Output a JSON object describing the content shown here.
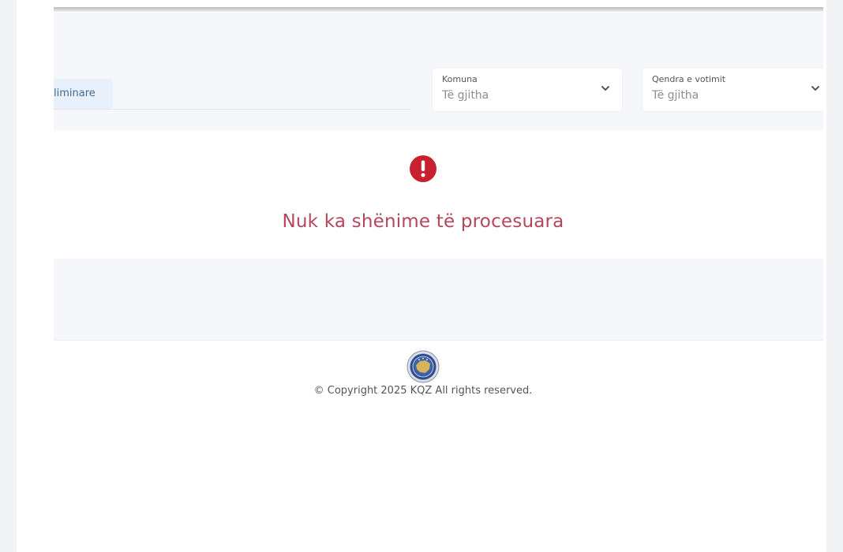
{
  "filters": {
    "tab_label": "liminare",
    "komuna": {
      "label": "Komuna",
      "value": "Të gjitha"
    },
    "qendra": {
      "label": "Qendra e votimit",
      "value": "Të gjitha"
    }
  },
  "empty_state": {
    "icon": "exclamation-circle-icon",
    "message": "Nuk ka shënime të procesuara",
    "color": "#c8202f"
  },
  "footer": {
    "logo": "kqz-seal-logo",
    "copyright": "© Copyright 2025 KQZ All rights reserved."
  }
}
